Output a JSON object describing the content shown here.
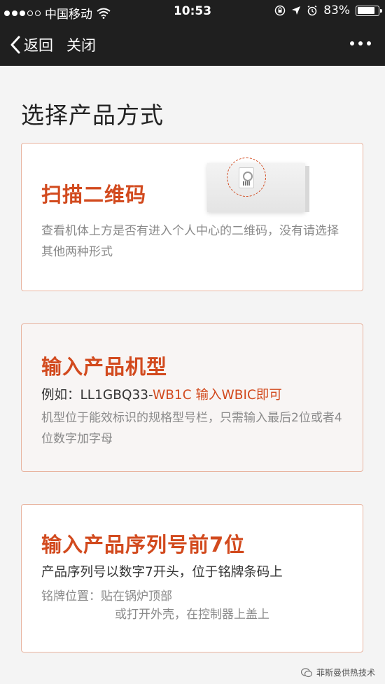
{
  "status_bar": {
    "carrier": "中国移动",
    "time": "10:53",
    "battery": "83%",
    "battery_fraction": 0.83
  },
  "nav": {
    "back_label": "返回",
    "close_label": "关闭"
  },
  "page": {
    "title": "选择产品方式"
  },
  "cards": [
    {
      "title": "扫描二维码",
      "desc": "查看机体上方是否有进入个人中心的二维码，没有请选择其他两种形式"
    },
    {
      "title": "输入产品机型",
      "example_prefix": "例如：LL1GBQ33-",
      "example_code": "WB1C",
      "example_action": " 输入WBIC即可",
      "desc": "机型位于能效标识的规格型号栏，只需输入最后2位或者4位数字加字母"
    },
    {
      "title": "输入产品序列号前7位",
      "line": "产品序列号以数字7开头，位于铭牌条码上",
      "location_label": "铭牌位置：",
      "location_1": "贴在锅炉顶部",
      "location_2": "或打开外壳，在控制器上盖上"
    }
  ],
  "watermark": "菲斯曼供热技术"
}
